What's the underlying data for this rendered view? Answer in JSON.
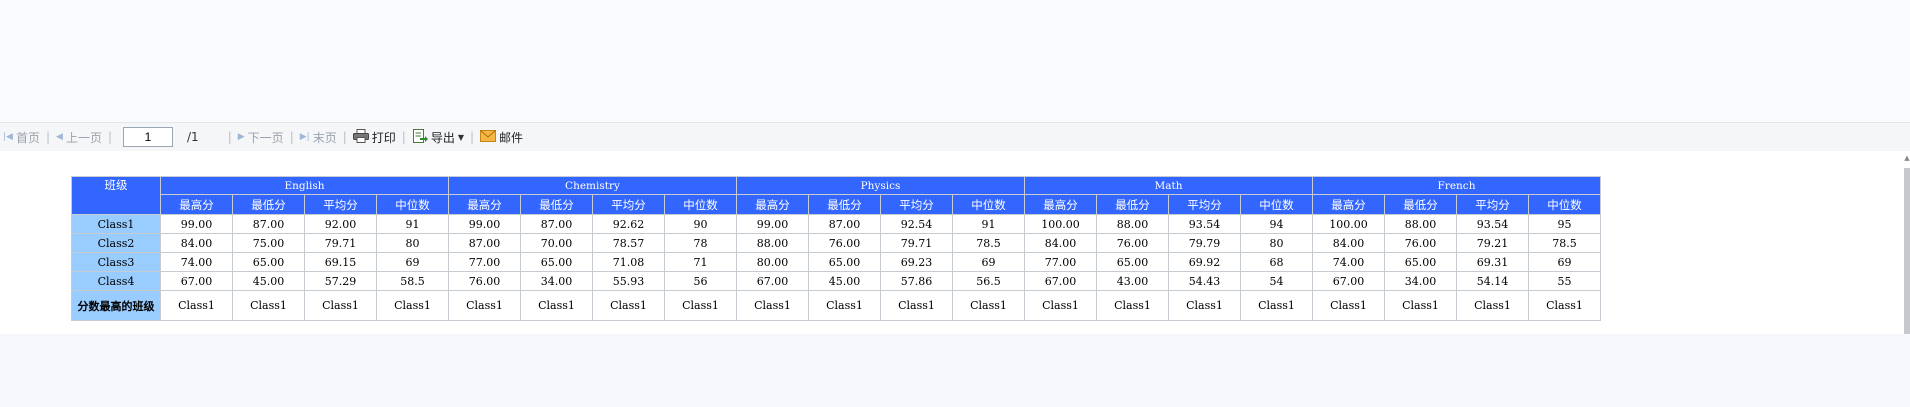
{
  "toolbar": {
    "first_label": "首页",
    "prev_label": "上一页",
    "page_current": "1",
    "page_total": "/1",
    "next_label": "下一页",
    "last_label": "末页",
    "print_label": "打印",
    "export_label": "导出",
    "mail_label": "邮件"
  },
  "report": {
    "corner_label": "班级",
    "subjects": [
      "English",
      "Chemistry",
      "Physics",
      "Math",
      "French"
    ],
    "stat_labels": [
      "最高分",
      "最低分",
      "平均分",
      "中位数"
    ],
    "rows": [
      {
        "label": "Class1",
        "values": [
          "99.00",
          "87.00",
          "92.00",
          "91",
          "99.00",
          "87.00",
          "92.62",
          "90",
          "99.00",
          "87.00",
          "92.54",
          "91",
          "100.00",
          "88.00",
          "93.54",
          "94",
          "100.00",
          "88.00",
          "93.54",
          "95"
        ]
      },
      {
        "label": "Class2",
        "values": [
          "84.00",
          "75.00",
          "79.71",
          "80",
          "87.00",
          "70.00",
          "78.57",
          "78",
          "88.00",
          "76.00",
          "79.71",
          "78.5",
          "84.00",
          "76.00",
          "79.79",
          "80",
          "84.00",
          "76.00",
          "79.21",
          "78.5"
        ]
      },
      {
        "label": "Class3",
        "values": [
          "74.00",
          "65.00",
          "69.15",
          "69",
          "77.00",
          "65.00",
          "71.08",
          "71",
          "80.00",
          "65.00",
          "69.23",
          "69",
          "77.00",
          "65.00",
          "69.92",
          "68",
          "74.00",
          "65.00",
          "69.31",
          "69"
        ]
      },
      {
        "label": "Class4",
        "values": [
          "67.00",
          "45.00",
          "57.29",
          "58.5",
          "76.00",
          "34.00",
          "55.93",
          "56",
          "67.00",
          "45.00",
          "57.86",
          "56.5",
          "67.00",
          "43.00",
          "54.43",
          "54",
          "67.00",
          "34.00",
          "54.14",
          "55"
        ]
      }
    ],
    "best_row": {
      "label": "分数最高的班级",
      "values": [
        "Class1",
        "Class1",
        "Class1",
        "Class1",
        "Class1",
        "Class1",
        "Class1",
        "Class1",
        "Class1",
        "Class1",
        "Class1",
        "Class1",
        "Class1",
        "Class1",
        "Class1",
        "Class1",
        "Class1",
        "Class1",
        "Class1",
        "Class1"
      ]
    }
  },
  "colors": {
    "header_bg": "#3366ff",
    "row_header_bg": "#99ccff",
    "toolbar_bg": "#f5f6f8"
  }
}
